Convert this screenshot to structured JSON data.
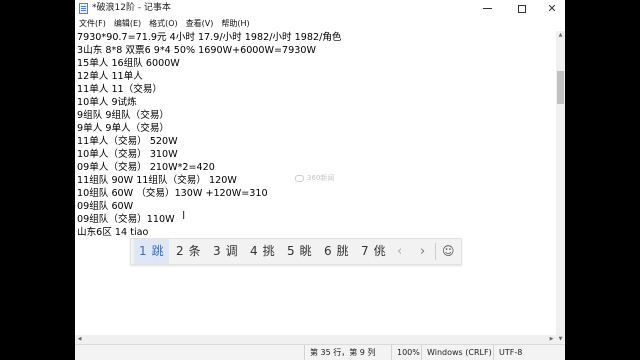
{
  "window": {
    "title": "*破浪12阶 - 记事本",
    "min_symbol": "",
    "close_symbol": "✕"
  },
  "menu": [
    "文件(F)",
    "编辑(E)",
    "格式(O)",
    "查看(V)",
    "帮助(H)"
  ],
  "document": {
    "lines": [
      "7930*90.7=71.9元 4小时 17.9/小时 1982/小时 1982/角色",
      "3山东 8*8 双票6 9*4 50% 1690W+6000W=7930W",
      "15单人 16组队 6000W",
      "12单人 11单人",
      "11单人 11（交易）",
      "10单人 9试炼",
      "9组队 9组队（交易）",
      "9单人 9单人（交易）",
      "11单人（交易） 520W",
      "10单人（交易） 310W",
      "09单人（交易） 210W*2=420",
      "11组队 90W 11组队（交易） 120W",
      "10组队 60W （交易）130W +120W=310",
      "09组队 60W",
      "09组队（交易）110W",
      "山东6区 14 tiao"
    ]
  },
  "watermark": "360新闻",
  "cursor_glyph": "I",
  "status": {
    "position": "第 35 行，第 9 列",
    "zoom": "100%",
    "line_ending": "Windows (CRLF)",
    "encoding": "UTF-8"
  },
  "ime": {
    "candidates": [
      {
        "num": "1",
        "text": "跳"
      },
      {
        "num": "2",
        "text": "条"
      },
      {
        "num": "3",
        "text": "调"
      },
      {
        "num": "4",
        "text": "挑"
      },
      {
        "num": "5",
        "text": "眺"
      },
      {
        "num": "6",
        "text": "朓"
      },
      {
        "num": "7",
        "text": "佻"
      }
    ],
    "prev": "‹",
    "next": "›",
    "emoji": "☺"
  },
  "colors": {
    "ime_highlight": "#dde7f5",
    "ime_highlight_text": "#3a6fb5"
  }
}
